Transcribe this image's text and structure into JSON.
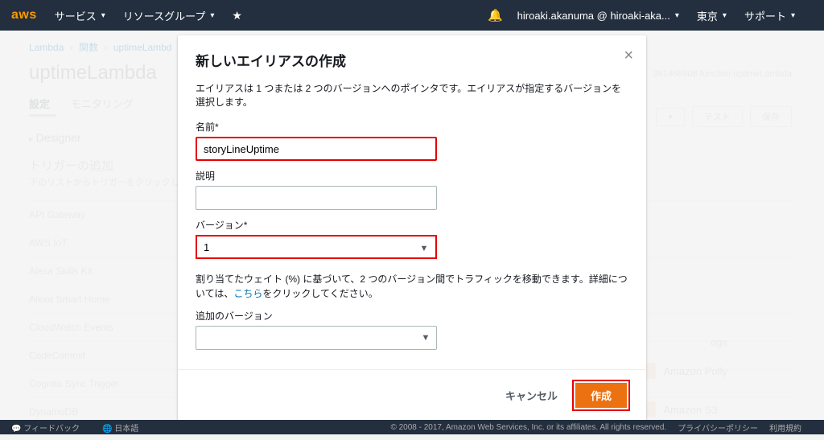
{
  "nav": {
    "logo": "aws",
    "services": "サービス",
    "resource_groups": "リソースグループ",
    "account": "hiroaki.akanuma @ hiroaki-aka...",
    "region": "東京",
    "support": "サポート"
  },
  "breadcrumbs": {
    "a": "Lambda",
    "b": "関数",
    "c": "uptimeLambd"
  },
  "arn_tail": "361468908:function:uptimeLambda",
  "func_name": "uptimeLambda",
  "tabs": {
    "config": "設定",
    "monitoring": "モニタリング"
  },
  "buttons": {
    "test": "テスト",
    "save": "保存"
  },
  "designer": "Designer",
  "triggers": {
    "title": "トリガーの追加",
    "sub": "下のリストからトリガーをクリックして、トリガーを関数に追加します。",
    "items": [
      "API Gateway",
      "AWS IoT",
      "Alexa Skills Kit",
      "Alexa Smart Home",
      "CloudWatch Events",
      "CodeCommit",
      "Cognito Sync Trigger",
      "DynamoDB"
    ]
  },
  "right_services": {
    "logs": "ogs",
    "polly": "Amazon Polly",
    "s3": "Amazon S3"
  },
  "modal": {
    "title": "新しいエイリアスの作成",
    "desc": "エイリアスは 1 つまたは 2 つのバージョンへのポインタです。エイリアスが指定するバージョンを選択します。",
    "name_label": "名前*",
    "name_value": "storyLineUptime",
    "desc_label": "説明",
    "desc_value": "",
    "version_label": "バージョン*",
    "version_value": "1",
    "weight_note_a": "割り当てたウェイト (%) に基づいて、2 つのバージョン間でトラフィックを移動できます。詳細については、",
    "weight_note_link": "こちら",
    "weight_note_b": "をクリックしてください。",
    "extra_version_label": "追加のバージョン",
    "extra_version_value": "",
    "cancel": "キャンセル",
    "create": "作成"
  },
  "footer": {
    "feedback": "フィードバック",
    "lang": "日本語",
    "copyright": "© 2008 - 2017, Amazon Web Services, Inc. or its affiliates. All rights reserved.",
    "privacy": "プライバシーポリシー",
    "terms": "利用規約"
  }
}
